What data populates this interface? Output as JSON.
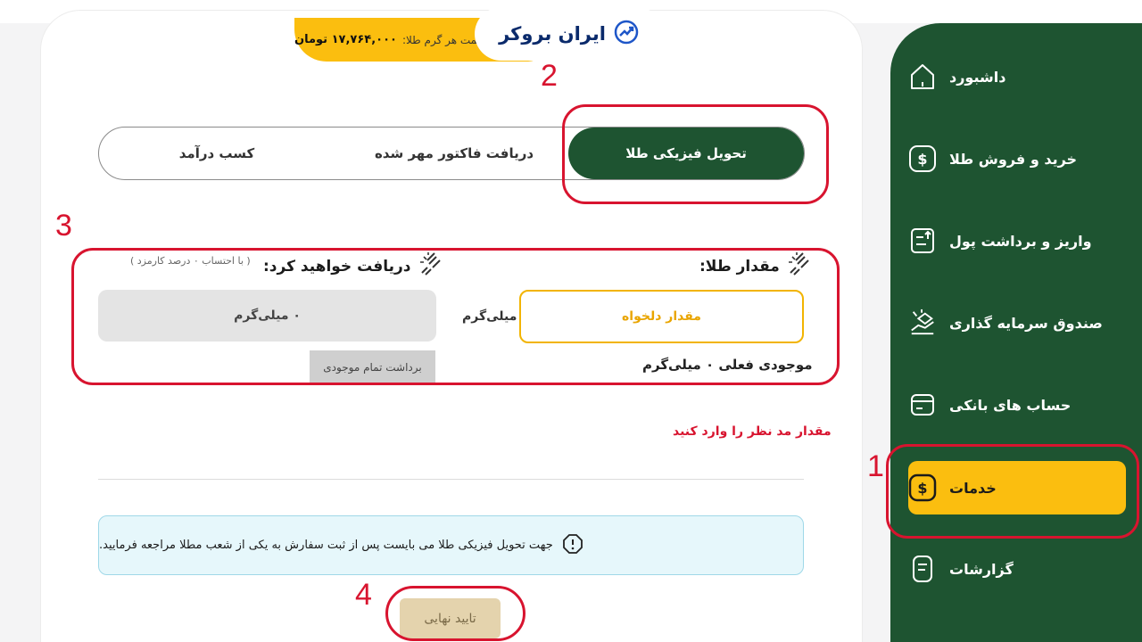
{
  "header": {
    "gold_price_label": "قیمت هر گرم طلا:",
    "gold_price_value": "۱۷,۷۶۴,۰۰۰ تومان",
    "logo_text": "ایران بروکر"
  },
  "sidebar": {
    "items": [
      {
        "label": "داشبورد",
        "icon": "home-icon"
      },
      {
        "label": "خرید و فروش طلا",
        "icon": "dollar-icon"
      },
      {
        "label": "واریز و برداشت پول",
        "icon": "transfer-icon"
      },
      {
        "label": "صندوق سرمایه گذاری",
        "icon": "investment-icon"
      },
      {
        "label": "حساب های بانکی",
        "icon": "bank-card-icon"
      },
      {
        "label": "خدمات",
        "icon": "services-dollar-icon",
        "active": true
      },
      {
        "label": "گزارشات",
        "icon": "report-icon"
      }
    ]
  },
  "tabs": [
    {
      "label": "تحویل فیزیکی طلا",
      "active": true
    },
    {
      "label": "دریافت فاکتور مهر شده",
      "active": false
    },
    {
      "label": "کسب درآمد",
      "active": false
    }
  ],
  "form": {
    "gold_amount_label": "مقدار طلا:",
    "receive_label": "دریافت خواهید کرد:",
    "fee_note": "( با احتساب ۰ درصد کارمزد )",
    "custom_amount_button": "مقدار دلخواه",
    "unit": "میلی‌گرم",
    "receive_value": "۰ میلی‌گرم",
    "balance_label": "موجودی فعلی",
    "balance_value": "۰",
    "balance_unit": "میلی‌گرم",
    "withdraw_all_button": "برداشت تمام موجودی",
    "error_message": "مقدار مد نظر را وارد کنید",
    "info_message": "جهت تحویل فیزیکی طلا می بایست پس از ثبت سفارش به یکی از شعب مطلا مراجعه فرمایید.",
    "confirm_button": "تایید نهایی"
  },
  "annotations": {
    "n1": "1",
    "n2": "2",
    "n3": "3",
    "n4": "4"
  },
  "colors": {
    "sidebar_green": "#1e5431",
    "accent_yellow": "#fbbe0f",
    "annotation_red": "#d8142f"
  }
}
